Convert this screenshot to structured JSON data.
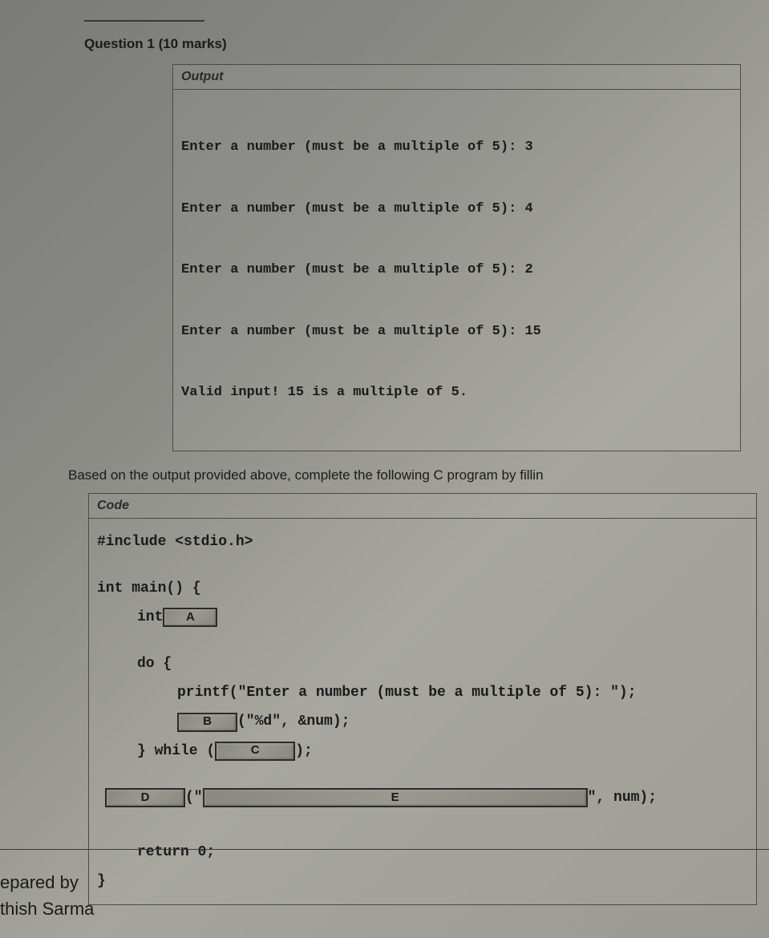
{
  "question": {
    "title": "Question 1 (10 marks)"
  },
  "output": {
    "header": "Output",
    "lines": [
      "Enter a number (must be a multiple of 5): 3",
      "Enter a number (must be a multiple of 5): 4",
      "Enter a number (must be a multiple of 5): 2",
      "Enter a number (must be a multiple of 5): 15",
      "Valid input! 15 is a multiple of 5."
    ]
  },
  "instruction": "Based on the output provided above, complete the following C program by fillin",
  "code": {
    "header": "Code",
    "include": "#include <stdio.h>",
    "main_open": "int main() {",
    "int_decl": "int ",
    "do_open": "do {",
    "printf_prompt": "printf(\"Enter a number (must be a multiple of 5): \");",
    "scanf_tail": "(\"%d\", &num);",
    "while_open": "} while (",
    "while_close": ");",
    "d_open": "(\"",
    "d_close": "\", num);",
    "return": "return 0;",
    "main_close": "}"
  },
  "blanks": {
    "a": "A",
    "b": "B",
    "c": "C",
    "d": "D",
    "e": "E"
  },
  "footer": {
    "line1": "epared by",
    "line2": "thish Sarma"
  }
}
